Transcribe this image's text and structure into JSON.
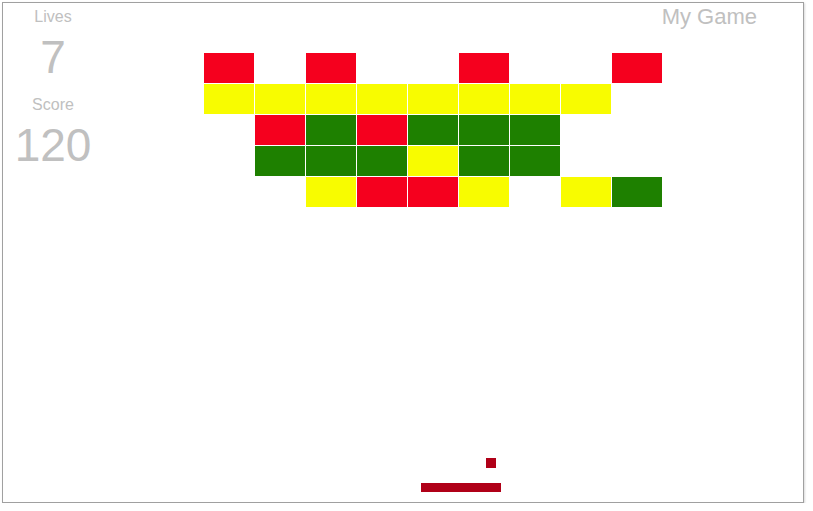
{
  "title": "My Game",
  "hud": [
    {
      "label": "Lives",
      "value": "7"
    },
    {
      "label": "Score",
      "value": "120"
    }
  ],
  "bricks": [
    [
      {
        "present": true,
        "color": "#f5001e"
      },
      {
        "present": false,
        "color": "#ffffff"
      },
      {
        "present": true,
        "color": "#f5001e"
      },
      {
        "present": false,
        "color": "#ffffff"
      },
      {
        "present": false,
        "color": "#ffffff"
      },
      {
        "present": true,
        "color": "#f5001e"
      },
      {
        "present": false,
        "color": "#ffffff"
      },
      {
        "present": false,
        "color": "#ffffff"
      },
      {
        "present": true,
        "color": "#f5001e"
      }
    ],
    [
      {
        "present": true,
        "color": "#f8fc00"
      },
      {
        "present": true,
        "color": "#f8fc00"
      },
      {
        "present": true,
        "color": "#f8fc00"
      },
      {
        "present": true,
        "color": "#f8fc00"
      },
      {
        "present": true,
        "color": "#f8fc00"
      },
      {
        "present": true,
        "color": "#f8fc00"
      },
      {
        "present": true,
        "color": "#f8fc00"
      },
      {
        "present": true,
        "color": "#f8fc00"
      },
      {
        "present": false,
        "color": "#ffffff"
      }
    ],
    [
      {
        "present": false,
        "color": "#ffffff"
      },
      {
        "present": true,
        "color": "#f5001e"
      },
      {
        "present": true,
        "color": "#1e8000"
      },
      {
        "present": true,
        "color": "#f5001e"
      },
      {
        "present": true,
        "color": "#1e8000"
      },
      {
        "present": true,
        "color": "#1e8000"
      },
      {
        "present": true,
        "color": "#1e8000"
      },
      {
        "present": false,
        "color": "#ffffff"
      },
      {
        "present": false,
        "color": "#ffffff"
      }
    ],
    [
      {
        "present": false,
        "color": "#ffffff"
      },
      {
        "present": true,
        "color": "#1e8000"
      },
      {
        "present": true,
        "color": "#1e8000"
      },
      {
        "present": true,
        "color": "#1e8000"
      },
      {
        "present": true,
        "color": "#f8fc00"
      },
      {
        "present": true,
        "color": "#1e8000"
      },
      {
        "present": true,
        "color": "#1e8000"
      },
      {
        "present": false,
        "color": "#ffffff"
      },
      {
        "present": false,
        "color": "#ffffff"
      }
    ],
    [
      {
        "present": false,
        "color": "#ffffff"
      },
      {
        "present": false,
        "color": "#ffffff"
      },
      {
        "present": true,
        "color": "#f8fc00"
      },
      {
        "present": true,
        "color": "#f5001e"
      },
      {
        "present": true,
        "color": "#f5001e"
      },
      {
        "present": true,
        "color": "#f8fc00"
      },
      {
        "present": false,
        "color": "#ffffff"
      },
      {
        "present": true,
        "color": "#f8fc00"
      },
      {
        "present": true,
        "color": "#1e8000"
      }
    ]
  ]
}
